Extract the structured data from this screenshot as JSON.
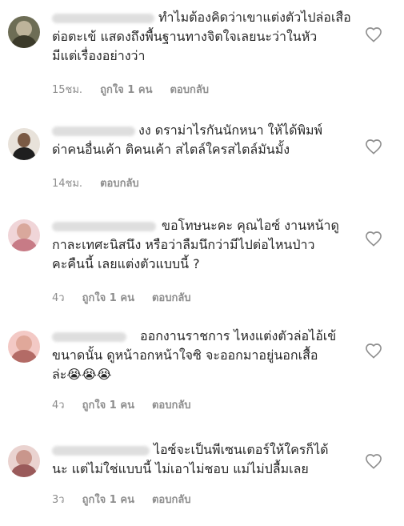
{
  "comments": [
    {
      "text_line1": "ทำไมต้องคิดว่าเขาแต่งตัวไปล่อเสือ",
      "text_rest": "ต่อตะเข้ แสดงถึงพื้นฐานทางจิตใจเลยนะว่าในหัว\nมีแต่เรื่องอย่างว่า",
      "time": "15ชม.",
      "likes": "ถูกใจ 1 คน",
      "reply": "ตอบกลับ"
    },
    {
      "text_line1": "งง ดราม่าไรกันนักหนา ให้ได้พิมพ์",
      "text_rest": "ด่าคนอื่นเค้า ติคนเค้า สไตล์ใครสไตล์มันมั้ง",
      "time": "14ชม.",
      "likes": "",
      "reply": "ตอบกลับ"
    },
    {
      "text_line1": "ขอโทษนะคะ คุณไอซ์ งานหน้าดู",
      "text_rest": "กาละเทศะนิสนึง หรือว่าลืมนึกว่ามีไปต่อไหนป่าว\nคะคืนนี้ เลยแต่งตัวแบบนี้ ?",
      "time": "4ว",
      "likes": "ถูกใจ 1 คน",
      "reply": "ตอบกลับ"
    },
    {
      "text_line1": "ออกงานราชการ ไหงแต่งตัวล่อไอ้เข้",
      "text_rest": "ขนาดนั้น ดูหน้าอกหน้าใจซิ จะออกมาอยู่นอกเสื้อ\nล่ะ😭😭😭",
      "time": "4ว",
      "likes": "ถูกใจ 1 คน",
      "reply": "ตอบกลับ"
    },
    {
      "text_line1": "ไอซ์จะเป็นพีเซนเตอร์ให้ใครก็ได้",
      "text_rest": "นะ แต่ไม่ใช่แบบนี้ ไม่เอาไม่ชอบ แม่ไม่ปลื้มเลย",
      "time": "3ว",
      "likes": "ถูกใจ 1 คน",
      "reply": "ตอบกลับ"
    }
  ],
  "icons": {
    "like": "heart-outline-icon"
  },
  "colors": {
    "text": "#262626",
    "meta": "#8e8e8e",
    "background": "#ffffff"
  }
}
